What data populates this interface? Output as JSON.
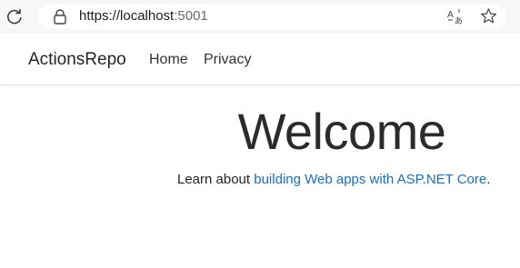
{
  "browser": {
    "url_host": "https://localhost",
    "url_port": ":5001"
  },
  "navbar": {
    "brand": "ActionsRepo",
    "links": [
      {
        "label": "Home"
      },
      {
        "label": "Privacy"
      }
    ]
  },
  "main": {
    "heading": "Welcome",
    "lead_prefix": "Learn about ",
    "lead_link": "building Web apps with ASP.NET Core",
    "lead_suffix": "."
  },
  "colors": {
    "link": "#1b6ec2",
    "text": "#212529",
    "chrome_bg": "#f7f7f7"
  },
  "icons": [
    "refresh-icon",
    "lock-icon",
    "translate-icon",
    "favorite-star-icon"
  ]
}
